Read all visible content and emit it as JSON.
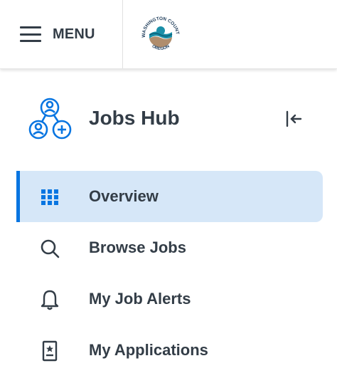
{
  "header": {
    "menu_label": "MENU",
    "logo_text_top": "WASHINGTON COUNTY",
    "logo_text_bottom": "OREGON"
  },
  "hub": {
    "title": "Jobs Hub",
    "icon": "people-network-icon",
    "collapse_icon": "collapse-left-icon"
  },
  "nav": {
    "items": [
      {
        "label": "Overview",
        "icon": "grid-icon",
        "active": true
      },
      {
        "label": "Browse Jobs",
        "icon": "search-icon",
        "active": false
      },
      {
        "label": "My Job Alerts",
        "icon": "bell-icon",
        "active": false
      },
      {
        "label": "My Applications",
        "icon": "document-star-icon",
        "active": false
      }
    ]
  },
  "colors": {
    "accent": "#0875e1",
    "active_bg": "#d6e7f8",
    "text": "#333d47"
  }
}
